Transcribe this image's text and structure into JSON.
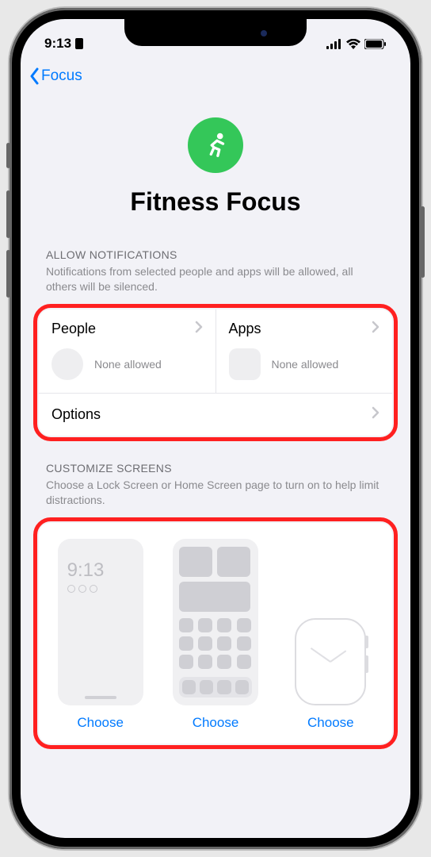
{
  "status": {
    "time": "9:13",
    "signal_icon": "signal-bars",
    "wifi_icon": "wifi",
    "battery_icon": "battery-full"
  },
  "nav": {
    "back_label": "Focus"
  },
  "hero": {
    "icon": "running-figure",
    "title": "Fitness Focus",
    "icon_bg": "#34c759"
  },
  "notifications_section": {
    "header": "ALLOW NOTIFICATIONS",
    "description": "Notifications from selected people and apps will be allowed, all others will be silenced.",
    "people": {
      "label": "People",
      "status": "None allowed"
    },
    "apps": {
      "label": "Apps",
      "status": "None allowed"
    },
    "options_label": "Options"
  },
  "screens_section": {
    "header": "CUSTOMIZE SCREENS",
    "description": "Choose a Lock Screen or Home Screen page to turn on to help limit distractions.",
    "lock_preview_time": "9:13",
    "choose_labels": [
      "Choose",
      "Choose",
      "Choose"
    ]
  },
  "colors": {
    "accent": "#007aff",
    "highlight": "#ff2020"
  }
}
